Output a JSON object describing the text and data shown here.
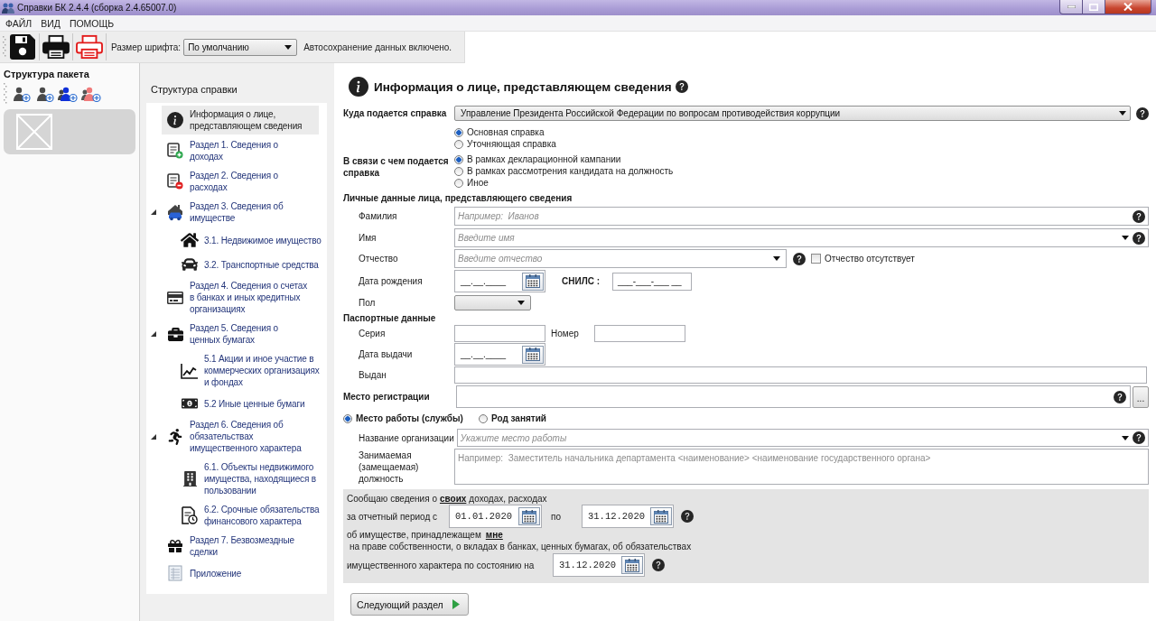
{
  "window": {
    "title": "Справки БК 2.4.4 (сборка 2.4.65007.0)"
  },
  "menu": [
    "ФАЙЛ",
    "ВИД",
    "ПОМОЩЬ"
  ],
  "toolbar": {
    "font_size_label": "Размер шрифта:",
    "font_size_value": "По умолчанию",
    "autosave_status": "Автосохранение данных включено."
  },
  "package_panel": {
    "title": "Структура пакета"
  },
  "structure_panel": {
    "title": "Структура справки",
    "items": [
      {
        "label": "Информация о лице, представляющем сведения",
        "selected": true
      },
      {
        "label": "Раздел 1. Сведения о доходах",
        "selected": false
      },
      {
        "label": "Раздел 2. Сведения о расходах",
        "selected": false
      },
      {
        "label": "Раздел 3. Сведения об имуществе",
        "selected": false,
        "expanded": true,
        "children": [
          {
            "label": "3.1. Недвижимое имущество",
            "selected": false
          },
          {
            "label": "3.2. Транспортные средства",
            "selected": false
          }
        ]
      },
      {
        "label": "Раздел 4. Сведения о счетах в банках и иных кредитных организациях",
        "selected": false
      },
      {
        "label": "Раздел 5. Сведения о ценных бумагах",
        "selected": false,
        "expanded": true,
        "children": [
          {
            "label": "5.1 Акции и иное участие в коммерческих организациях и фондах",
            "selected": false
          },
          {
            "label": "5.2 Иные ценные бумаги",
            "selected": false
          }
        ]
      },
      {
        "label": "Раздел 6. Сведения об обязательствах имущественного характера",
        "selected": false,
        "expanded": true,
        "children": [
          {
            "label": "6.1. Объекты недвижимого имущества, находящиеся в пользовании",
            "selected": false
          },
          {
            "label": "6.2. Срочные обязательства финансового характера",
            "selected": false
          }
        ]
      },
      {
        "label": "Раздел 7. Безвозмездные сделки",
        "selected": false
      },
      {
        "label": "Приложение",
        "selected": false
      }
    ]
  },
  "form": {
    "title": "Информация о лице, представляющем сведения",
    "recipient": {
      "label": "Куда подается справка",
      "value": "Управление Президента Российской Федерации по вопросам противодействия коррупции"
    },
    "certificate_type": [
      {
        "label": "Основная справка",
        "selected": true
      },
      {
        "label": "Уточняющая справка",
        "selected": false
      }
    ],
    "reason": {
      "label": "В связи с чем подается справка",
      "options": [
        {
          "label": "В рамках декларационной кампании",
          "selected": true
        },
        {
          "label": "В рамках рассмотрения кандидата на должность",
          "selected": false
        },
        {
          "label": "Иное",
          "selected": false
        }
      ]
    },
    "personal_heading": "Личные данные лица, представляющего сведения",
    "surname": {
      "label": "Фамилия",
      "placeholder": "Например:  Иванов"
    },
    "name": {
      "label": "Имя",
      "placeholder": "Введите имя"
    },
    "patronymic": {
      "label": "Отчество",
      "placeholder": "Введите отчество",
      "absent": {
        "label": "Отчество отсутствует",
        "checked": false
      }
    },
    "birth_date": {
      "label": "Дата рождения",
      "value": "__.__.____"
    },
    "snils": {
      "label": "СНИЛС :",
      "value": "___-___-___ __"
    },
    "gender": {
      "label": "Пол"
    },
    "passport": {
      "heading": "Паспортные данные",
      "series_label": "Серия",
      "number_label": "Номер",
      "issue_date_label": "Дата выдачи",
      "issue_date_value": "__.__.____",
      "issued_by_label": "Выдан"
    },
    "registration": {
      "label": "Место регистрации",
      "browse_button": "..."
    },
    "employment": {
      "options": [
        {
          "label": "Место работы (службы)",
          "selected": true
        },
        {
          "label": "Род занятий",
          "selected": false
        }
      ],
      "organization_label": "Название организации",
      "organization_placeholder": "Укажите место работы",
      "position_label": "Занимаемая (замещаемая) должность",
      "position_placeholder": "Например:  Заместитель начальника департамента <наименование> <наименование государственного органа>"
    },
    "statement": {
      "line1_before": "Сообщаю сведения о",
      "line1_link": "своих",
      "line1_after": "доходах, расходах",
      "period_from_label": "за отчетный период с",
      "period_from": "01.01.2020",
      "period_to_label": "по",
      "period_to": "31.12.2020",
      "line3_before": "об имуществе, принадлежащем",
      "line3_link": "мне",
      "line4": "на праве собственности, о вкладах в банках, ценных бумагах, об обязательствах",
      "as_of_label": "имущественного характера по состоянию на",
      "as_of": "31.12.2020"
    },
    "next_button": "Следующий раздел"
  }
}
